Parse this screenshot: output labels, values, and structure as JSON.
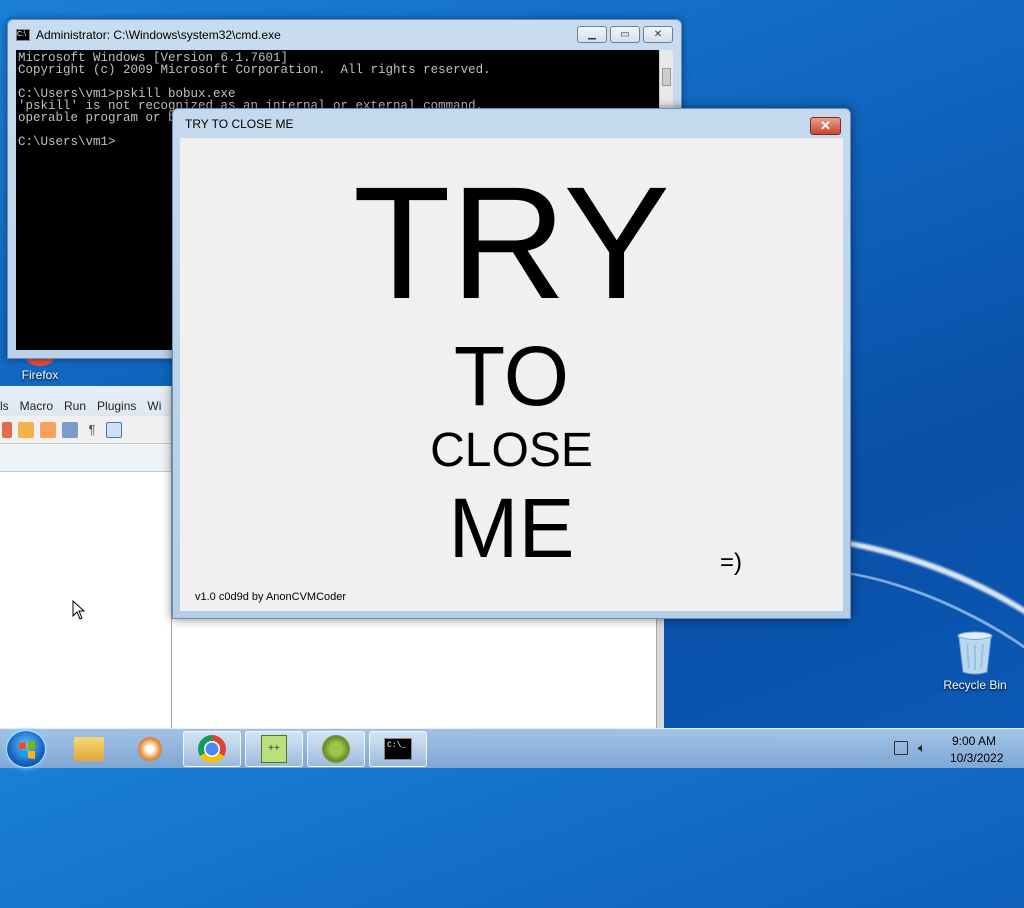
{
  "cmd": {
    "title": "Administrator: C:\\Windows\\system32\\cmd.exe",
    "lines": "Microsoft Windows [Version 6.1.7601]\nCopyright (c) 2009 Microsoft Corporation.  All rights reserved.\n\nC:\\Users\\vm1>pskill bobux.exe\n'pskill' is not recognized as an internal or external command,\noperable program or batch file.\n\nC:\\Users\\vm1>"
  },
  "desktop": {
    "firefox_label": "Firefox",
    "recycle_label": "Recycle Bin"
  },
  "npp": {
    "menu": [
      "ls",
      "Macro",
      "Run",
      "Plugins",
      "Wi"
    ]
  },
  "popup": {
    "title": "TRY TO CLOSE ME",
    "close_glyph": "✕",
    "word1": "TRY",
    "word2": "TO",
    "word3": "CLOSE",
    "word4": "ME",
    "smiley": "=)",
    "credit": "v1.0 c0d9d by AnonCVMCoder"
  },
  "taskbar": {
    "time": "9:00 AM",
    "date": "10/3/2022",
    "items": [
      "windows-explorer",
      "media-player",
      "chrome",
      "notepad-plus-plus",
      "app-gears",
      "command-prompt"
    ]
  },
  "colors": {
    "accent": "#0f63be",
    "close_red": "#c7452d"
  }
}
